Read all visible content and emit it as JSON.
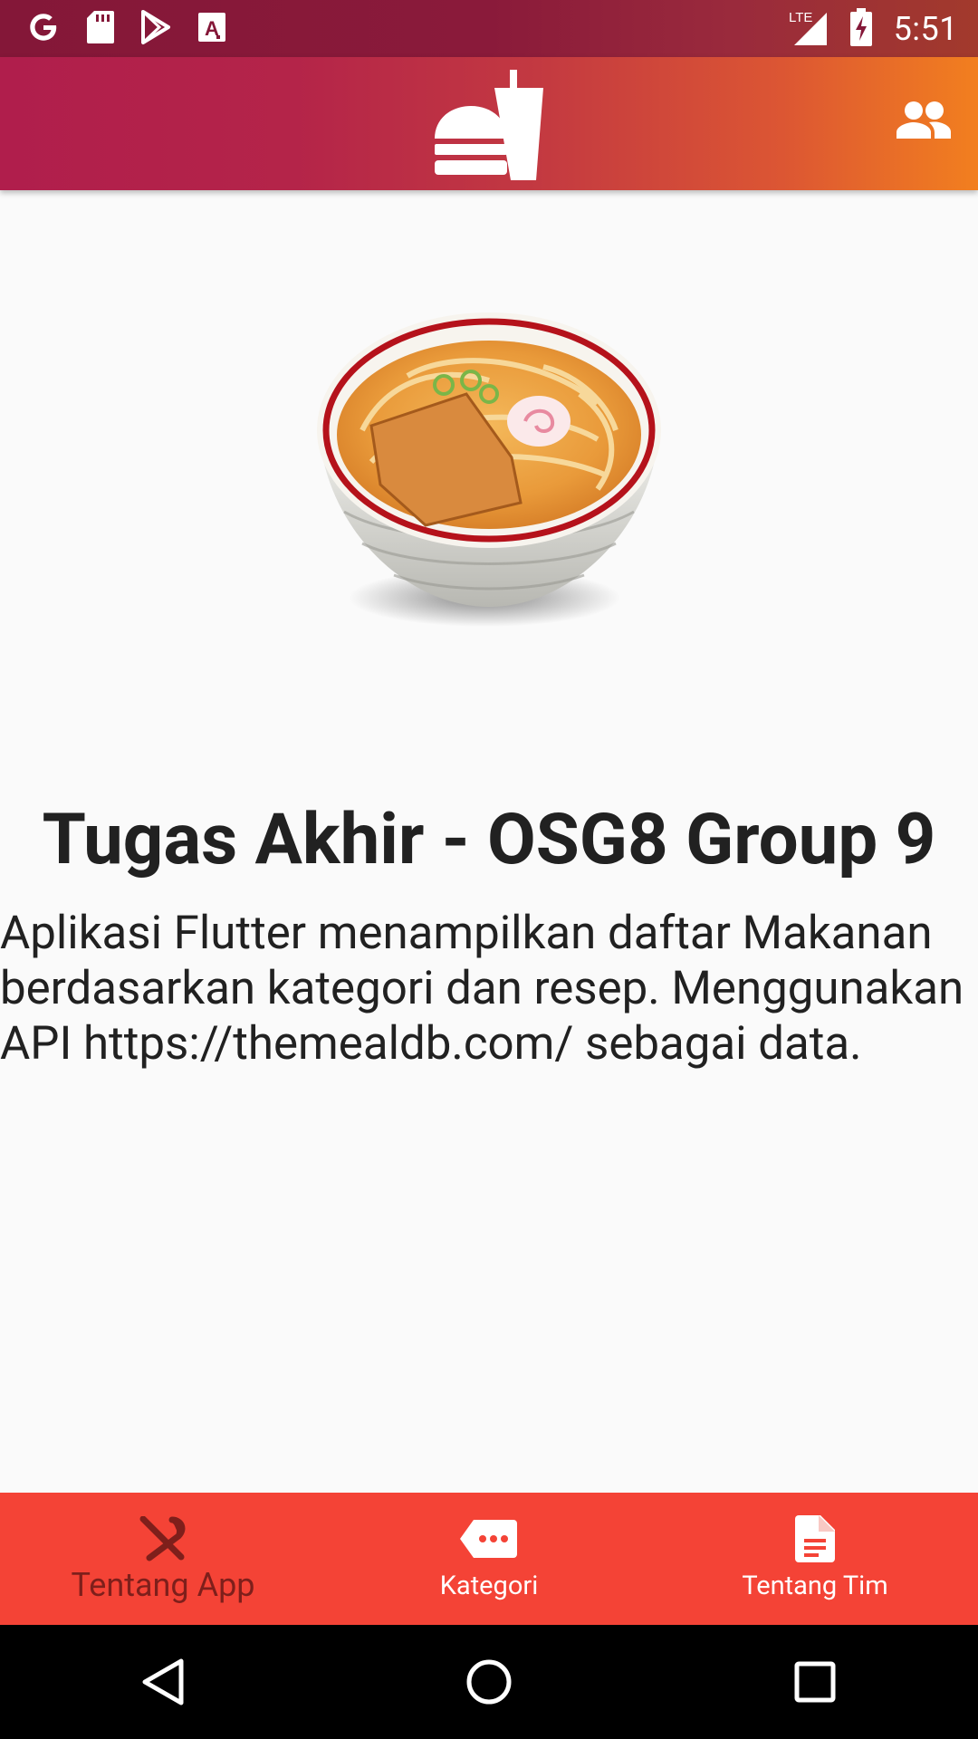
{
  "status_bar": {
    "time": "5:51",
    "network": "LTE",
    "icons": [
      "google-icon",
      "sd-card-icon",
      "play-store-icon",
      "a-icon",
      "signal-icon",
      "battery-charging-icon"
    ]
  },
  "app_bar": {
    "logo": "fastfood-icon",
    "action": "people-icon"
  },
  "hero": {
    "image": "udon-bowl-illustration"
  },
  "content": {
    "title": "Tugas Akhir - OSG8 Group 9",
    "description": "Aplikasi Flutter menampilkan daftar Makanan berdasarkan kategori dan resep. Menggunakan API https://themealdb.com/ sebagai data."
  },
  "bottom_nav": {
    "items": [
      {
        "label": "Tentang App",
        "icon": "restaurant-icon",
        "active": true
      },
      {
        "label": "Kategori",
        "icon": "more-tag-icon",
        "active": false
      },
      {
        "label": "Tentang Tim",
        "icon": "document-icon",
        "active": false
      }
    ]
  },
  "colors": {
    "status_bar": "#841738",
    "app_bar_start": "#b01e4c",
    "app_bar_end": "#f27f1f",
    "bottom_nav": "#f44336",
    "active_nav": "#7e1f1b",
    "background": "#fafafa",
    "text": "#212121"
  },
  "system_nav": [
    "back-icon",
    "home-icon",
    "recents-icon"
  ]
}
